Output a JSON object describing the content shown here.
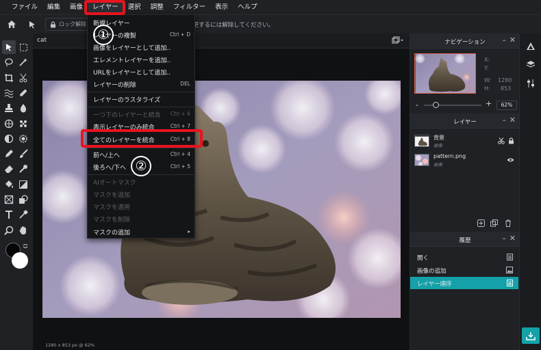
{
  "menubar": {
    "items": [
      "ファイル",
      "編集",
      "画像",
      "レイヤー",
      "選択",
      "調整",
      "フィルター",
      "表示",
      "ヘルプ"
    ],
    "active_index": 3
  },
  "toolbar": {
    "lock_label": "ロック解除",
    "notice": "レイヤーはロックされています。変更するには解除してください。"
  },
  "document": {
    "tab_name": "cat",
    "status": "1280 x 853 px @ 62%"
  },
  "navigation": {
    "title": "ナビゲーション",
    "x_label": "X:",
    "y_label": "Y:",
    "w_label": "W:",
    "w_value": "1280",
    "h_label": "H:",
    "h_value": "853",
    "zoom_value": "62%",
    "zoom_level_fraction": 0.2
  },
  "layers_panel": {
    "title": "レイヤー",
    "layers": [
      {
        "name": "背景",
        "sub": "画像"
      },
      {
        "name": "pattern.png",
        "sub": "画像"
      }
    ]
  },
  "history_panel": {
    "title": "履歴",
    "items": [
      "開く",
      "画像の追加",
      "レイヤー順序"
    ],
    "active_index": 2
  },
  "layer_menu": {
    "items": [
      {
        "label": "新規レイヤー",
        "shortcut": "",
        "disabled": false
      },
      {
        "label": "レイヤーの複製",
        "shortcut": "Ctrl + D",
        "disabled": false
      },
      {
        "label": "画像をレイヤーとして追加..",
        "shortcut": "",
        "disabled": false
      },
      {
        "label": "エレメントレイヤーを追加..",
        "shortcut": "",
        "disabled": false
      },
      {
        "label": "URLをレイヤーとして追加..",
        "shortcut": "",
        "disabled": false
      },
      {
        "label": "レイヤーの削除",
        "shortcut": "DEL",
        "disabled": false
      },
      {
        "label": "レイヤーのラスタライズ",
        "shortcut": "",
        "disabled": false
      },
      {
        "label": "一つ下のレイヤーと統合",
        "shortcut": "Ctrl + 6",
        "disabled": true
      },
      {
        "label": "表示レイヤーのみ統合",
        "shortcut": "Ctrl + 7",
        "disabled": false
      },
      {
        "label": "全てのレイヤーを統合",
        "shortcut": "Ctrl + 8",
        "disabled": false
      },
      {
        "label": "前へ/上へ",
        "shortcut": "Ctrl + 4",
        "disabled": false
      },
      {
        "label": "後ろへ/下へ",
        "shortcut": "Ctrl + 5",
        "disabled": false
      },
      {
        "label": "AIオートマスク",
        "shortcut": "",
        "disabled": true
      },
      {
        "label": "マスクを追加",
        "shortcut": "",
        "disabled": true
      },
      {
        "label": "マスクを適用",
        "shortcut": "",
        "disabled": true
      },
      {
        "label": "マスクを削除",
        "shortcut": "",
        "disabled": true
      },
      {
        "label": "マスクの追加",
        "shortcut": "",
        "disabled": false
      }
    ]
  },
  "annotations": {
    "step1": "①",
    "step2": "②"
  },
  "colors": {
    "accent": "#14a1a9",
    "highlight": "#e8141e"
  }
}
